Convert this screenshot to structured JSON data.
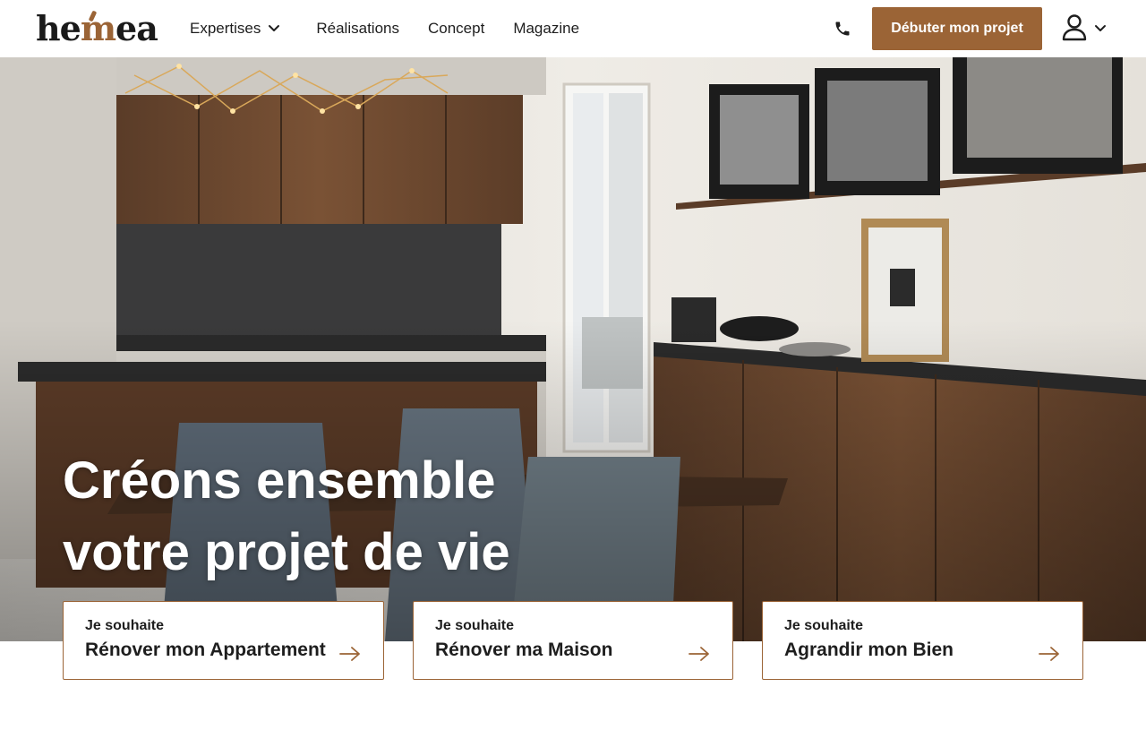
{
  "brand": {
    "logo_prefix": "he",
    "logo_m": "m",
    "logo_suffix": "ea",
    "accent": "#9b6436"
  },
  "nav": {
    "items": [
      {
        "label": "Expertises",
        "has_dropdown": true
      },
      {
        "label": "Réalisations"
      },
      {
        "label": "Concept"
      },
      {
        "label": "Magazine"
      }
    ]
  },
  "header": {
    "phone_icon": "phone-icon",
    "cta_label": "Débuter mon projet",
    "account_icon": "user-icon"
  },
  "hero": {
    "title_line1": "Créons ensemble",
    "title_line2": "votre projet de vie"
  },
  "cards": [
    {
      "prefix": "Je souhaite",
      "label": "Rénover mon Appartement"
    },
    {
      "prefix": "Je souhaite",
      "label": "Rénover ma Maison"
    },
    {
      "prefix": "Je souhaite",
      "label": "Agrandir mon Bien"
    }
  ]
}
